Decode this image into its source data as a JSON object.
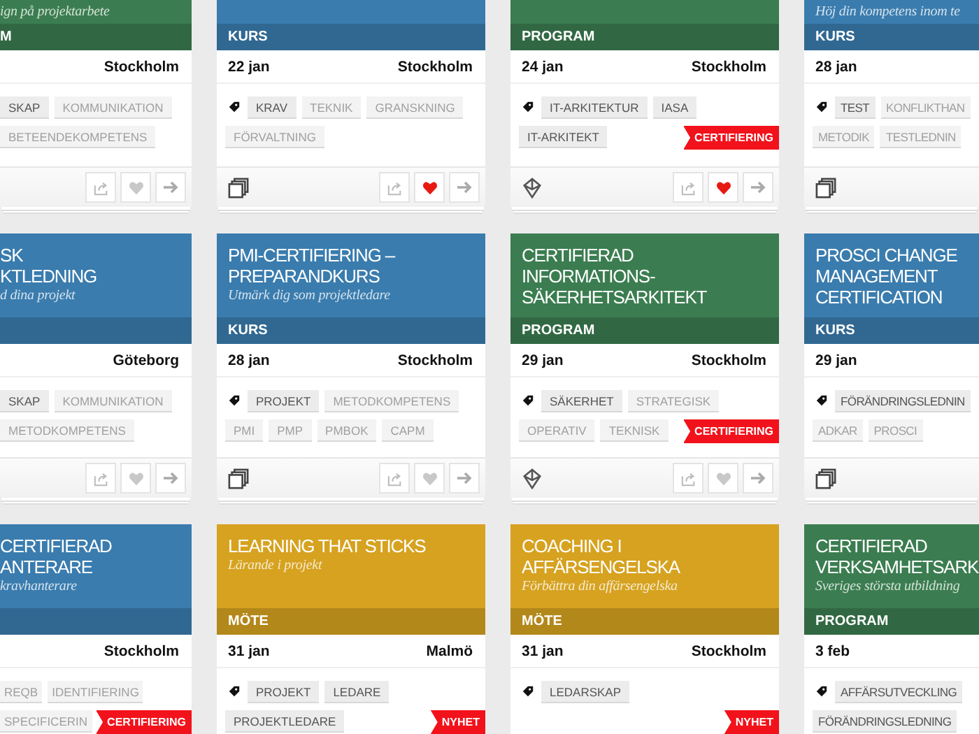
{
  "rows": [
    {
      "cards": [
        {
          "color": "#3b7d50",
          "subtitle": "ign på projektarbete",
          "type": "M",
          "location": "Stockholm",
          "tags": [
            {
              "label": "SKAP",
              "highlighted": true
            },
            {
              "label": "KOMMUNIKATION",
              "highlighted": false
            },
            {
              "label": "BETEENDEKOMPETENS",
              "highlighted": false
            }
          ],
          "footer": {
            "buttons": [
              {
                "kind": "share"
              },
              {
                "kind": "heart",
                "liked": false
              },
              {
                "kind": "arrow"
              }
            ]
          }
        },
        {
          "color": "#3a7cae",
          "type": "KURS",
          "date": "22 jan",
          "location": "Stockholm",
          "tags": [
            {
              "label": "KRAV",
              "highlighted": true
            },
            {
              "label": "TEKNIK",
              "highlighted": false
            },
            {
              "label": "GRANSKNING",
              "highlighted": false
            },
            {
              "label": "FÖRVALTNING",
              "highlighted": false
            }
          ],
          "footer": {
            "kind": "stack",
            "buttons": [
              {
                "kind": "share"
              },
              {
                "kind": "heart",
                "liked": true
              },
              {
                "kind": "arrow"
              }
            ]
          }
        },
        {
          "color": "#3b7d50",
          "type": "PROGRAM",
          "date": "24 jan",
          "location": "Stockholm",
          "tags": [
            {
              "label": "IT-ARKITEKTUR",
              "highlighted": true
            },
            {
              "label": "IASA",
              "highlighted": true
            },
            {
              "label": "IT-ARKITEKT",
              "highlighted": true
            }
          ],
          "ribbon": "CERTIFIERING",
          "footer": {
            "kind": "logo",
            "buttons": [
              {
                "kind": "share"
              },
              {
                "kind": "heart",
                "liked": true
              },
              {
                "kind": "arrow"
              }
            ]
          }
        },
        {
          "color": "#3a7cae",
          "subtitle": "Höj din kompetens inom te",
          "type": "KURS",
          "date": "28 jan",
          "tags": [
            {
              "label": "TEST",
              "highlighted": true
            },
            {
              "label": "KONFLIKTHAN",
              "highlighted": false
            },
            {
              "label": "METODIK",
              "highlighted": false
            },
            {
              "label": "TESTLEDNIN",
              "highlighted": false
            }
          ],
          "footer": {
            "kind": "stack"
          }
        }
      ]
    },
    {
      "cards": [
        {
          "color": "#3a7cae",
          "title_lines": [
            "SK",
            "KTLEDNING"
          ],
          "subtitle": "d dina projekt",
          "location": "Göteborg",
          "tags": [
            {
              "label": "SKAP",
              "highlighted": true
            },
            {
              "label": "KOMMUNIKATION",
              "highlighted": false
            },
            {
              "label": "METODKOMPETENS",
              "highlighted": false
            }
          ],
          "footer": {
            "buttons": [
              {
                "kind": "share"
              },
              {
                "kind": "heart",
                "liked": false
              },
              {
                "kind": "arrow"
              }
            ]
          }
        },
        {
          "color": "#3a7cae",
          "title_lines": [
            "PMI-CERTIFIERING –",
            "PREPARANDKURS"
          ],
          "subtitle": "Utmärk dig som projektledare",
          "type": "KURS",
          "date": "28 jan",
          "location": "Stockholm",
          "tags": [
            {
              "label": "PROJEKT",
              "highlighted": true
            },
            {
              "label": "METODKOMPETENS",
              "highlighted": false
            },
            {
              "label": "PMI",
              "highlighted": false
            },
            {
              "label": "PMP",
              "highlighted": false
            },
            {
              "label": "PMBOK",
              "highlighted": false
            },
            {
              "label": "CAPM",
              "highlighted": false
            }
          ],
          "footer": {
            "kind": "stack",
            "buttons": [
              {
                "kind": "share"
              },
              {
                "kind": "heart",
                "liked": false
              },
              {
                "kind": "arrow"
              }
            ]
          }
        },
        {
          "color": "#3b7d50",
          "title_lines": [
            "CERTIFIERAD",
            "INFORMATIONS-",
            "SÄKERHETSARKITEKT"
          ],
          "type": "PROGRAM",
          "date": "29 jan",
          "location": "Stockholm",
          "tags": [
            {
              "label": "SÄKERHET",
              "highlighted": true
            },
            {
              "label": "STRATEGISK",
              "highlighted": false
            },
            {
              "label": "OPERATIV",
              "highlighted": false
            },
            {
              "label": "TEKNISK",
              "highlighted": false
            }
          ],
          "ribbon": "CERTIFIERING",
          "footer": {
            "kind": "logo",
            "buttons": [
              {
                "kind": "share"
              },
              {
                "kind": "heart",
                "liked": false
              },
              {
                "kind": "arrow"
              }
            ]
          }
        },
        {
          "color": "#3a7cae",
          "title_lines": [
            "PROSCI CHANGE",
            "MANAGEMENT",
            "CERTIFICATION"
          ],
          "type": "KURS",
          "date": "29 jan",
          "tags": [
            {
              "label": "FÖRÄNDRINGSLEDNIN",
              "highlighted": true
            },
            {
              "label": "ADKAR",
              "highlighted": false
            },
            {
              "label": "PROSCI",
              "highlighted": false
            }
          ],
          "footer": {
            "kind": "stack"
          }
        }
      ]
    },
    {
      "cards": [
        {
          "color": "#3a7cae",
          "title_lines": [
            "CERTIFIERAD",
            "ANTERARE"
          ],
          "subtitle": "kravhanterare",
          "location": "Stockholm",
          "tags": [
            {
              "label": "REQB",
              "highlighted": false
            },
            {
              "label": "IDENTIFIERING",
              "highlighted": false
            },
            {
              "label": "SPECIFICERIN",
              "highlighted": false
            }
          ],
          "ribbon": "CERTIFIERING"
        },
        {
          "color": "#d6a21f",
          "title_lines": [
            "LEARNING THAT STICKS"
          ],
          "subtitle": "Lärande i projekt",
          "type": "MÖTE",
          "date": "31 jan",
          "location": "Malmö",
          "tags": [
            {
              "label": "PROJEKT",
              "highlighted": true
            },
            {
              "label": "LEDARE",
              "highlighted": true
            },
            {
              "label": "PROJEKTLEDARE",
              "highlighted": true
            }
          ],
          "ribbon": "NYHET"
        },
        {
          "color": "#d6a21f",
          "title_lines": [
            "COACHING I",
            "AFFÄRSENGELSKA"
          ],
          "subtitle": "Förbättra din affärsengelska",
          "type": "MÖTE",
          "date": "31 jan",
          "location": "Stockholm",
          "tags": [
            {
              "label": "LEDARSKAP",
              "highlighted": true
            }
          ],
          "ribbon": "NYHET"
        },
        {
          "color": "#3b7d50",
          "title_lines": [
            "CERTIFIERAD",
            "VERKSAMHETSARK"
          ],
          "subtitle": "Sveriges största utbildning",
          "type": "PROGRAM",
          "date": "3 feb",
          "tags": [
            {
              "label": "AFFÄRSUTVECKLING",
              "highlighted": true
            },
            {
              "label": "FÖRÄNDRINGSLEDNING",
              "highlighted": true
            }
          ]
        }
      ]
    }
  ]
}
